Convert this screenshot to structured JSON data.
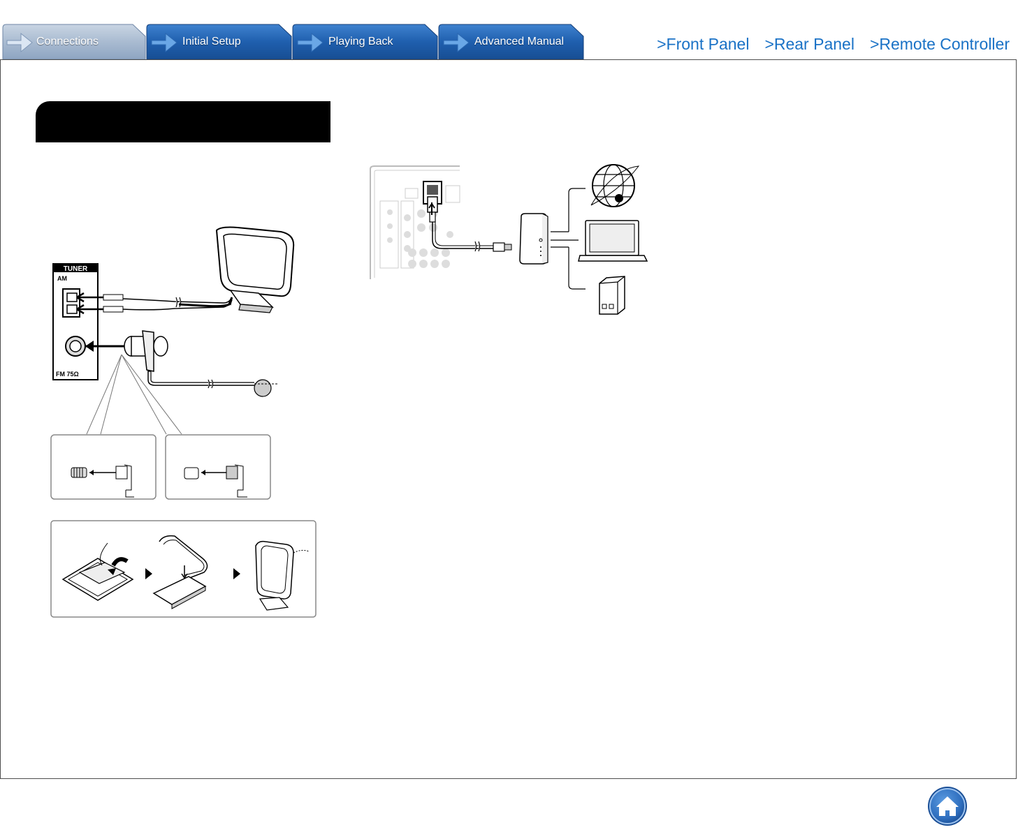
{
  "tabs": [
    {
      "label": "Connections",
      "active": true
    },
    {
      "label": "Initial Setup",
      "active": false
    },
    {
      "label": "Playing Back",
      "active": false
    },
    {
      "label": "Advanced Manual",
      "active": false
    }
  ],
  "links": {
    "front_panel": ">Front Panel",
    "rear_panel": ">Rear Panel",
    "remote_controller": ">Remote Controller"
  },
  "section": {
    "title": ""
  },
  "tuner_panel": {
    "title": "TUNER",
    "am_label": "AM",
    "fm_label": "FM 75Ω"
  },
  "colors": {
    "tab_active": "#9fb3cc",
    "tab_inactive": "#1f5fae",
    "link": "#1a72c6",
    "home_button": "#2f6fbf"
  },
  "icons": {
    "home": "home-icon",
    "tab_arrow": "arrow-right-icon"
  }
}
